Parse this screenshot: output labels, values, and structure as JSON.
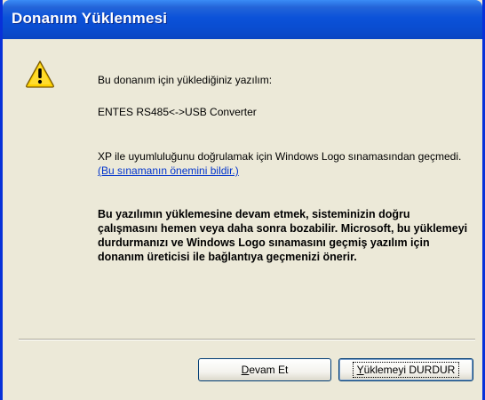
{
  "window": {
    "title": "Donanım Yüklenmesi"
  },
  "icons": {
    "warning": "warning-triangle-icon"
  },
  "message": {
    "intro": "Bu donanım için yüklediğiniz yazılım:",
    "software_name": "ENTES RS485<->USB Converter",
    "logo_text": "XP ile uyumluluğunu doğrulamak için Windows Logo sınamasından geçmedi.",
    "logo_link": "(Bu sınamanın önemini bildir.)",
    "warning_body": "Bu yazılımın yüklemesine devam etmek, sisteminizin doğru çalışmasını hemen veya daha sonra bozabilir. Microsoft, bu yüklemeyi durdurmanızı ve Windows Logo sınamasını geçmiş yazılım için donanım üreticisi ile bağlantıya geçmenizi önerir."
  },
  "buttons": {
    "continue_first": "D",
    "continue_rest": "evam Et",
    "stop_first": "Y",
    "stop_rest": "üklemeyi DURDUR"
  },
  "colors": {
    "title_bar": "#0a4ccf",
    "dialog_background": "#ece9d8",
    "link": "#0033cc",
    "warning_yellow": "#ffd200"
  }
}
